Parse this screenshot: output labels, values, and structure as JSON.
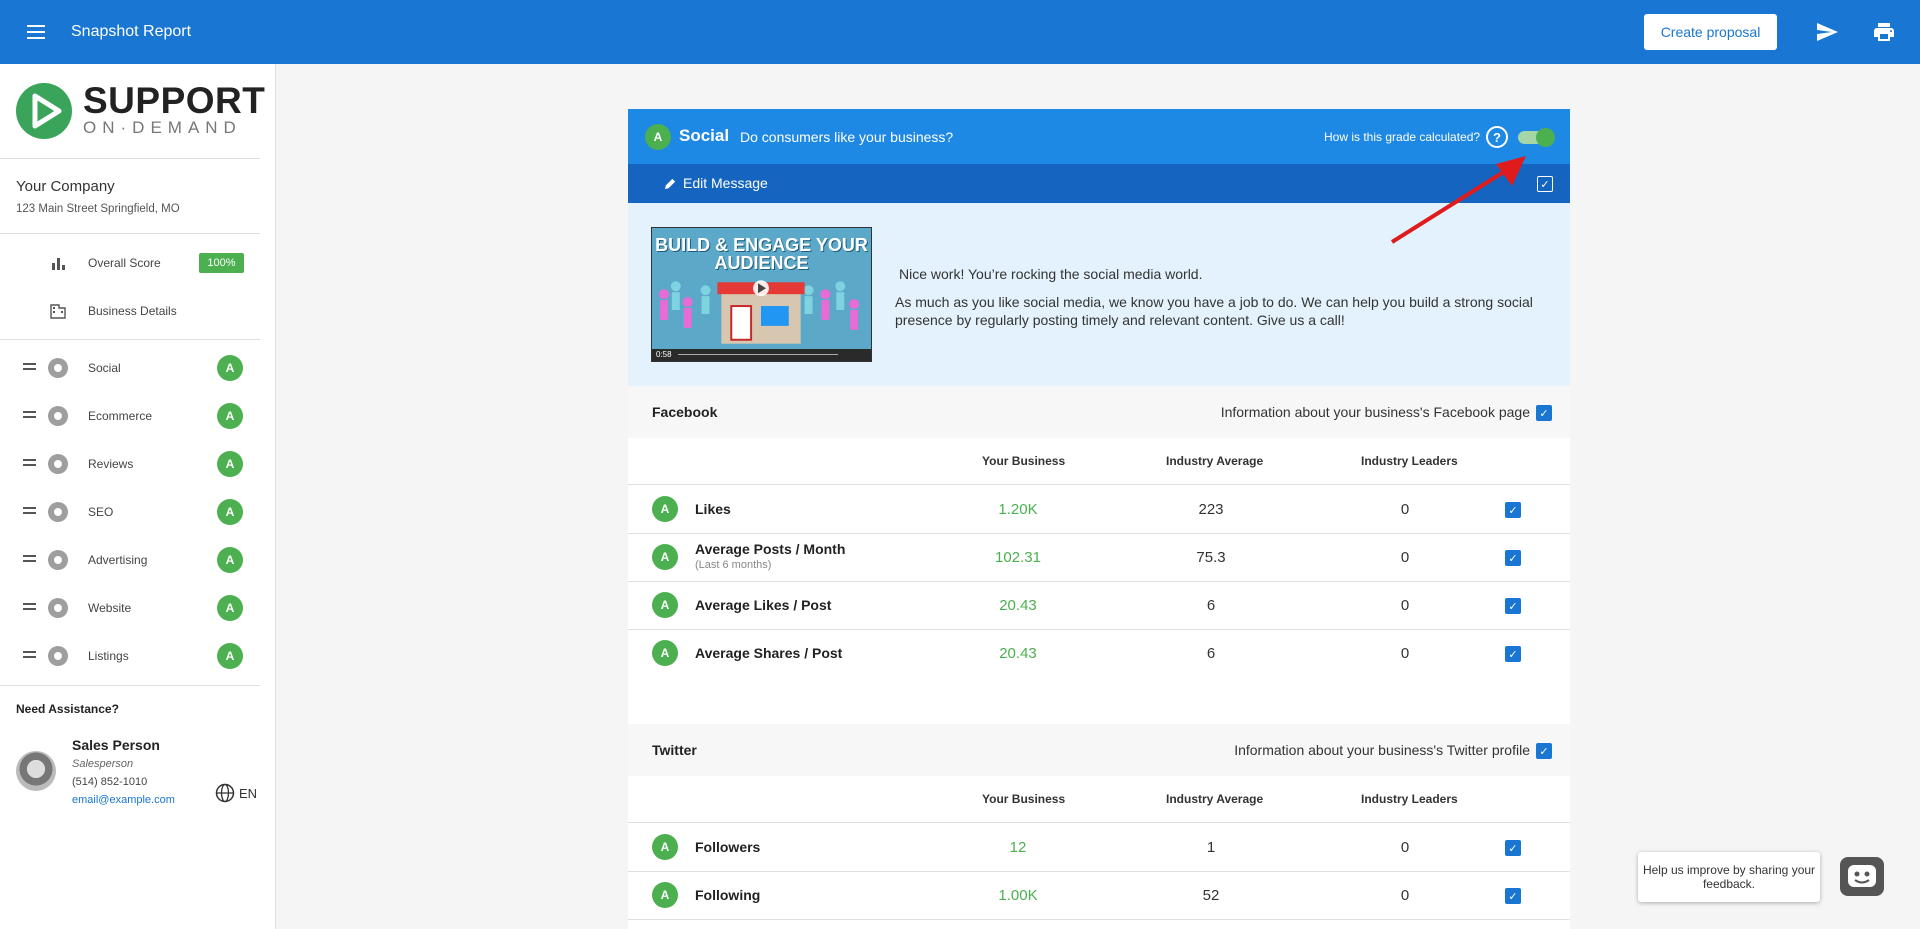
{
  "topbar": {
    "title": "Snapshot Report",
    "create_label": "Create proposal"
  },
  "logo": {
    "line1": "SUPPORT",
    "line2": "ON·DEMAND"
  },
  "company": {
    "name": "Your Company",
    "address": "123 Main Street Springfield, MO"
  },
  "nav": {
    "overall": {
      "label": "Overall Score",
      "badge": "100%"
    },
    "business": {
      "label": "Business Details"
    }
  },
  "sections": [
    {
      "label": "Social",
      "grade": "A",
      "icon": "chat-icon"
    },
    {
      "label": "Ecommerce",
      "grade": "A",
      "icon": "cart-icon"
    },
    {
      "label": "Reviews",
      "grade": "A",
      "icon": "star-icon"
    },
    {
      "label": "SEO",
      "grade": "A",
      "icon": "search-icon"
    },
    {
      "label": "Advertising",
      "grade": "A",
      "icon": "megaphone-icon"
    },
    {
      "label": "Website",
      "grade": "A",
      "icon": "browser-icon"
    },
    {
      "label": "Listings",
      "grade": "A",
      "icon": "location-icon"
    }
  ],
  "assistance": {
    "title": "Need Assistance?",
    "name": "Sales Person",
    "role": "Salesperson",
    "phone": "(514) 852-1010",
    "email": "email@example.com",
    "lang": "EN"
  },
  "card": {
    "grade": "A",
    "title": "Social",
    "subtitle": "Do consumers like your business?",
    "how_label": "How is this grade calculated?",
    "help_glyph": "?",
    "edit_label": "Edit Message",
    "video_title": "BUILD & ENGAGE YOUR AUDIENCE",
    "video_time": "0:58",
    "message1": "Nice work! You’re rocking the social media world.",
    "message2": "As much as you like social media, we know you have a job to do. We can help you build a strong social presence by regularly posting timely and relevant content. Give us a call!"
  },
  "columns": {
    "yours": "Your Business",
    "avg": "Industry Average",
    "leaders": "Industry Leaders"
  },
  "facebook": {
    "title": "Facebook",
    "info": "Information about your business's Facebook page",
    "rows": [
      {
        "grade": "A",
        "label": "Likes",
        "sub": "",
        "yours": "1.20K",
        "avg": "223",
        "leaders": "0"
      },
      {
        "grade": "A",
        "label": "Average Posts / Month",
        "sub": "(Last 6 months)",
        "yours": "102.31",
        "avg": "75.3",
        "leaders": "0"
      },
      {
        "grade": "A",
        "label": "Average Likes / Post",
        "sub": "",
        "yours": "20.43",
        "avg": "6",
        "leaders": "0"
      },
      {
        "grade": "A",
        "label": "Average Shares / Post",
        "sub": "",
        "yours": "20.43",
        "avg": "6",
        "leaders": "0"
      }
    ]
  },
  "twitter": {
    "title": "Twitter",
    "info": "Information about your business's Twitter profile",
    "rows": [
      {
        "grade": "A",
        "label": "Followers",
        "yours": "12",
        "avg": "1",
        "leaders": "0"
      },
      {
        "grade": "A",
        "label": "Following",
        "yours": "1.00K",
        "avg": "52",
        "leaders": "0"
      }
    ]
  },
  "feedback": {
    "text": "Help us improve by sharing your feedback."
  },
  "colors": {
    "primary": "#1976d2",
    "header": "#1e88e5",
    "edit_bar": "#1565c0",
    "grade_green": "#4caf50",
    "message_bg": "#e3f2fd",
    "annotation_arrow": "#e01b1b"
  }
}
